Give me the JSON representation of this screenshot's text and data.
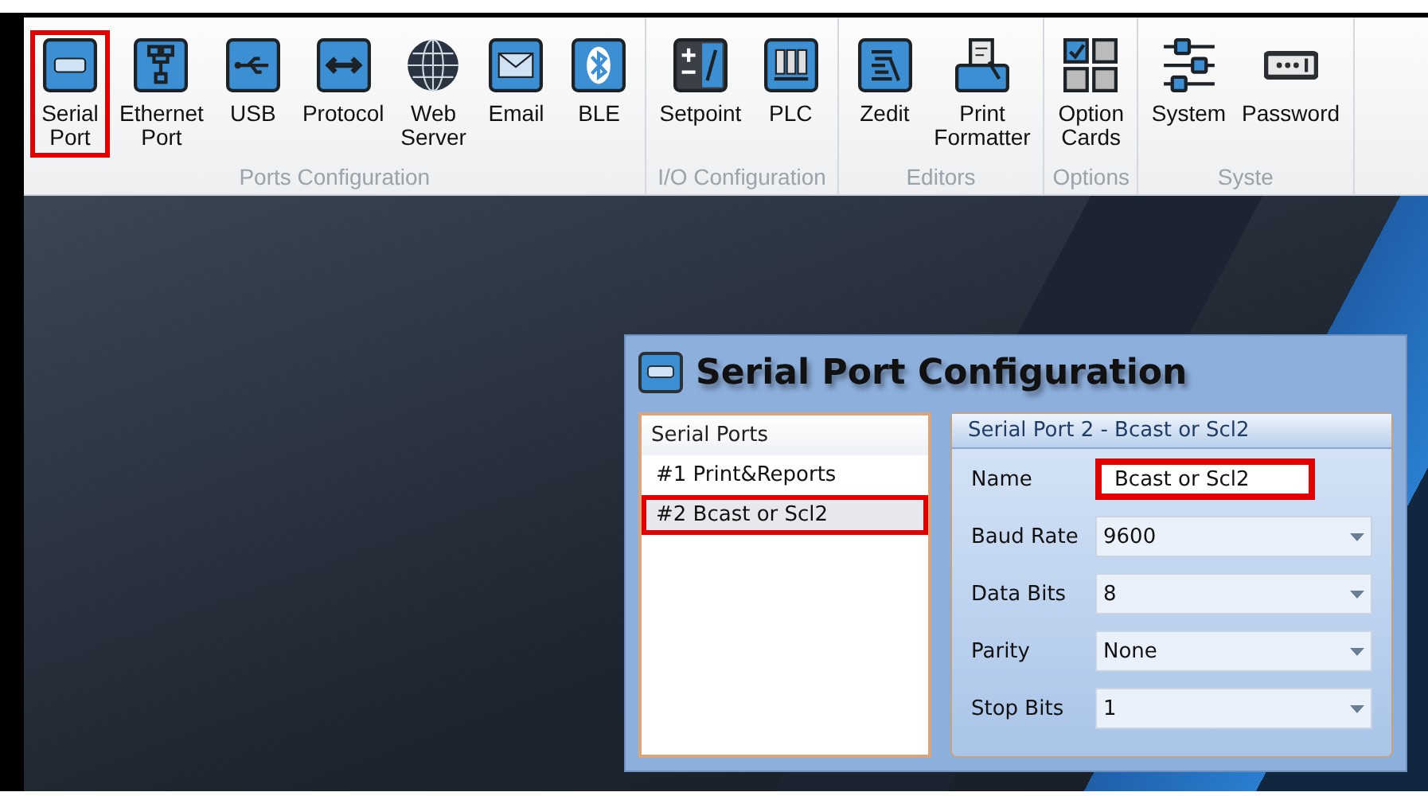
{
  "ribbon": {
    "groups": [
      {
        "label": "Ports Configuration",
        "buttons": [
          {
            "label": "Serial\nPort",
            "highlighted": true
          },
          {
            "label": "Ethernet\nPort",
            "highlighted": false
          },
          {
            "label": "USB",
            "highlighted": false
          },
          {
            "label": "Protocol",
            "highlighted": false
          },
          {
            "label": "Web\nServer",
            "highlighted": false
          },
          {
            "label": "Email",
            "highlighted": false
          },
          {
            "label": "BLE",
            "highlighted": false
          }
        ]
      },
      {
        "label": "I/O Configuration",
        "buttons": [
          {
            "label": "Setpoint",
            "highlighted": false
          },
          {
            "label": "PLC",
            "highlighted": false
          }
        ]
      },
      {
        "label": "Editors",
        "buttons": [
          {
            "label": "Zedit",
            "highlighted": false
          },
          {
            "label": "Print\nFormatter",
            "highlighted": false
          }
        ]
      },
      {
        "label": "Options",
        "buttons": [
          {
            "label": "Option\nCards",
            "highlighted": false
          }
        ]
      },
      {
        "label": "Syste",
        "buttons": [
          {
            "label": "System",
            "highlighted": false
          },
          {
            "label": "Password",
            "highlighted": false
          }
        ]
      }
    ]
  },
  "dialog": {
    "title": "Serial Port Configuration",
    "list": {
      "header": "Serial Ports",
      "items": [
        {
          "label": "#1 Print&Reports",
          "selected": false,
          "highlighted": false
        },
        {
          "label": "#2 Bcast or Scl2",
          "selected": true,
          "highlighted": true
        }
      ]
    },
    "panel": {
      "title": "Serial Port 2 - Bcast or Scl2",
      "fields": [
        {
          "kind": "text",
          "label": "Name",
          "value": "Bcast or Scl2",
          "highlighted": true
        },
        {
          "kind": "dropdown",
          "label": "Baud Rate",
          "value": "9600",
          "highlighted": false
        },
        {
          "kind": "dropdown",
          "label": "Data Bits",
          "value": "8",
          "highlighted": false
        },
        {
          "kind": "dropdown",
          "label": "Parity",
          "value": "None",
          "highlighted": false
        },
        {
          "kind": "dropdown",
          "label": "Stop Bits",
          "value": "1",
          "highlighted": false
        }
      ]
    }
  }
}
